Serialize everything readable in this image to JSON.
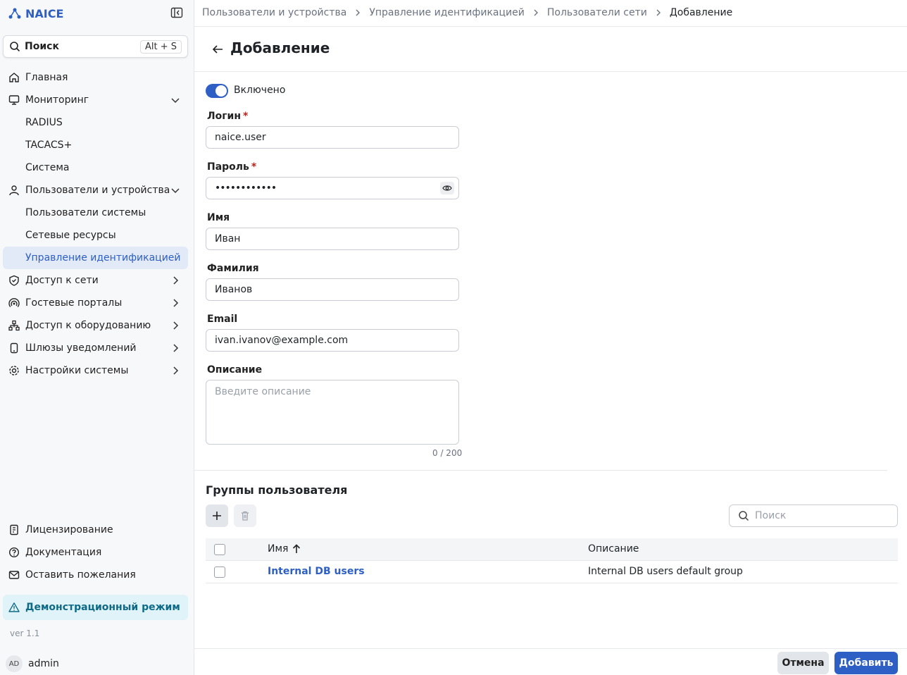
{
  "app": {
    "title": "NAICE",
    "version": "ver 1.1"
  },
  "sidebar": {
    "search_label": "Поиск",
    "search_shortcut": "Alt + S",
    "items": [
      {
        "label": "Главная"
      },
      {
        "label": "Мониторинг"
      },
      {
        "label": "RADIUS"
      },
      {
        "label": "TACACS+"
      },
      {
        "label": "Система"
      },
      {
        "label": "Пользователи и устройства"
      },
      {
        "label": "Пользователи системы"
      },
      {
        "label": "Сетевые ресурсы"
      },
      {
        "label": "Управление идентификацией"
      },
      {
        "label": "Доступ к сети"
      },
      {
        "label": "Гостевые порталы"
      },
      {
        "label": "Доступ к оборудованию"
      },
      {
        "label": "Шлюзы уведомлений"
      },
      {
        "label": "Настройки системы"
      }
    ],
    "bottom_items": [
      {
        "label": "Лицензирование"
      },
      {
        "label": "Документация"
      },
      {
        "label": "Оставить пожелания"
      }
    ],
    "demo_mode": "Демонстрационный режим",
    "user": {
      "initials": "AD",
      "name": "admin"
    }
  },
  "breadcrumb": [
    "Пользователи и устройства",
    "Управление идентификацией",
    "Пользователи сети",
    "Добавление"
  ],
  "page": {
    "title": "Добавление"
  },
  "form": {
    "enabled_label": "Включено",
    "enabled": true,
    "login_label": "Логин",
    "login_value": "naice.user",
    "password_label": "Пароль",
    "password_value": "••••••••••••",
    "first_name_label": "Имя",
    "first_name_value": "Иван",
    "last_name_label": "Фамилия",
    "last_name_value": "Иванов",
    "email_label": "Email",
    "email_value": "ivan.ivanov@example.com",
    "description_label": "Описание",
    "description_placeholder": "Введите описание",
    "description_counter": "0 / 200",
    "required_mark": "*"
  },
  "groups": {
    "title": "Группы пользователя",
    "search_placeholder": "Поиск",
    "columns": {
      "name": "Имя",
      "description": "Описание"
    },
    "rows": [
      {
        "name": "Internal DB users",
        "description": "Internal DB users default group"
      }
    ]
  },
  "footer": {
    "cancel_label": "Отмена",
    "add_label": "Добавить"
  },
  "colors": {
    "accent": "#2d5fc4",
    "demo_bg": "#dff3f9",
    "demo_text": "#0e6a86",
    "required": "#b3261e"
  }
}
